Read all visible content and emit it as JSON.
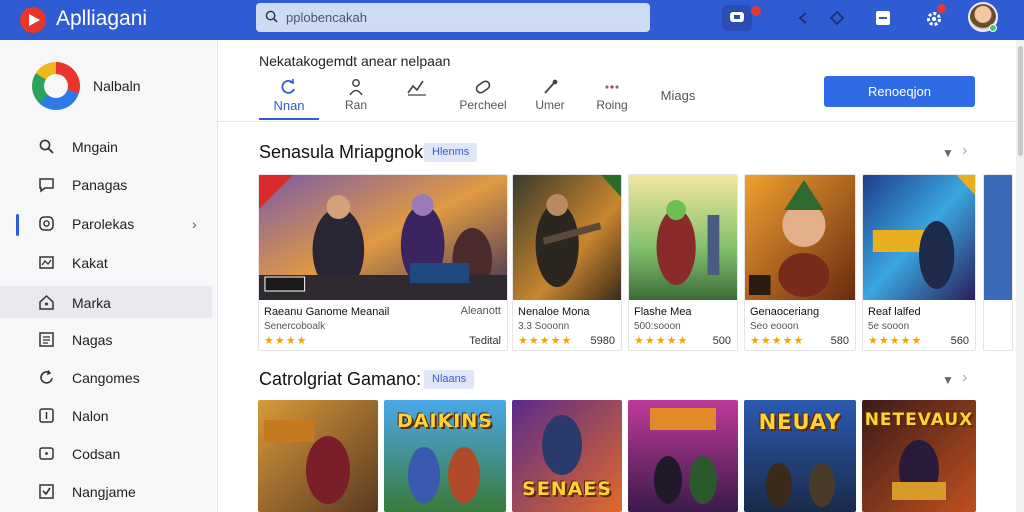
{
  "topbar": {
    "app_title": "Aplliagani",
    "search_value": "pplobencakah",
    "search_placeholder": "pplobencakah",
    "icons": [
      "app-logo-icon",
      "search-icon",
      "message-icon",
      "back-arrow-icon",
      "forward-arrow-icon",
      "window-icon",
      "gear-icon",
      "avatar"
    ]
  },
  "sidebar": {
    "brand": "Nalbaln",
    "items": [
      {
        "label": "Mngain",
        "icon": "search-icon"
      },
      {
        "label": "Panagas",
        "icon": "chat-icon"
      },
      {
        "label": "Parolekas",
        "icon": "circle-icon"
      },
      {
        "label": "Kakat",
        "icon": "image-icon"
      },
      {
        "label": "Marka",
        "icon": "home-icon"
      },
      {
        "label": "Nagas",
        "icon": "list-icon"
      },
      {
        "label": "Cangomes",
        "icon": "refresh-icon"
      },
      {
        "label": "Nalon",
        "icon": "frame-icon"
      },
      {
        "label": "Codsan",
        "icon": "window-icon"
      },
      {
        "label": "Nangjame",
        "icon": "check-icon"
      }
    ],
    "active_index": 4
  },
  "header": {
    "subtitle": "Nekatakogemdt anear nelpaan",
    "tabs": [
      "Nnan",
      "Ran",
      "Percheel",
      "Umer",
      "Roing",
      "Miags"
    ],
    "cta_label": "Renoeqjon"
  },
  "section1": {
    "title": "Senasula Mriapgnok",
    "pill": "Hlenms",
    "cards": [
      {
        "title": "Raeanu Ganome Meanail",
        "dev": "Senercoboalk",
        "more": "Aleanott",
        "sub2": "",
        "price": "Tedital",
        "stars": "★★★★"
      },
      {
        "title": "Nenaloe Mona",
        "dev": "3.3 Sooonn",
        "more": "",
        "price": "5980",
        "stars": "★★★★★"
      },
      {
        "title": "Flashe Mea",
        "dev": "500:sooon",
        "more": "",
        "price": "500",
        "stars": "★★★★★"
      },
      {
        "title": "Genaoceriang",
        "dev": "Seo eooon",
        "more": "",
        "price": "580",
        "stars": "★★★★★"
      },
      {
        "title": "Reaf lalfed",
        "dev": "5e sooon",
        "more": "",
        "price": "560",
        "stars": "★★★★★"
      }
    ]
  },
  "section2": {
    "title": "Catrolgriat Gamano:",
    "pill": "Nlaans",
    "cards": [
      {
        "label": ""
      },
      {
        "label": "DAIKINS"
      },
      {
        "label": "SENAES"
      },
      {
        "label": ""
      },
      {
        "label": "NEUAY"
      },
      {
        "label": "NETEVAUX"
      }
    ]
  },
  "colors": {
    "topbar": "#2f5bd3",
    "accent": "#2f6be6",
    "stars": "#f2a500",
    "badge": "#e53935"
  }
}
